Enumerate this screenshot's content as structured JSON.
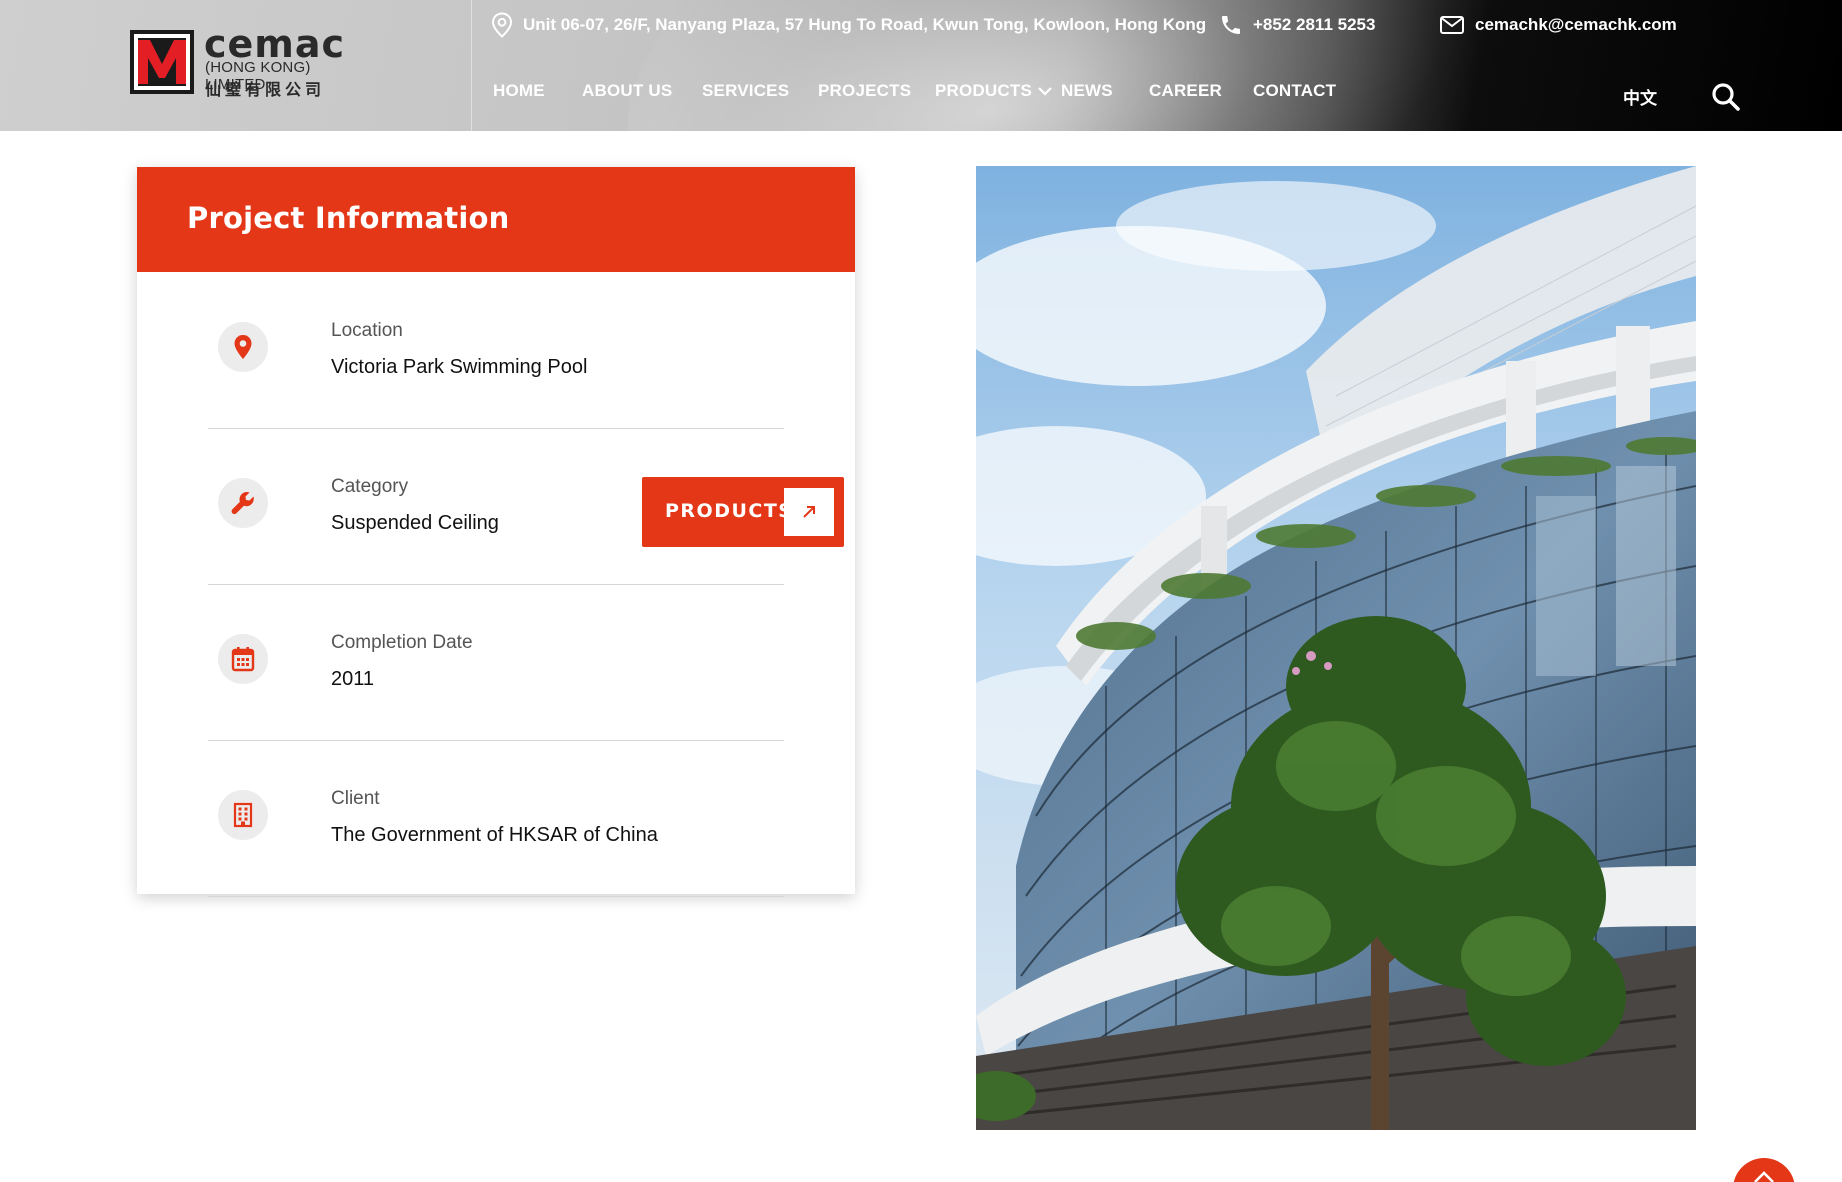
{
  "brand": {
    "name": "cemac",
    "subtitle": "(HONG KONG) LIMITED",
    "chinese_name": "仙璧有限公司",
    "logo_letter": "M",
    "primary_color": "#e33718"
  },
  "contact": {
    "address": "Unit 06-07, 26/F, Nanyang Plaza, 57 Hung To Road, Kwun Tong, Kowloon, Hong Kong",
    "phone": "+852 2811 5253",
    "email": "cemachk@cemachk.com"
  },
  "nav": {
    "items": [
      {
        "label": "HOME"
      },
      {
        "label": "ABOUT US"
      },
      {
        "label": "SERVICES"
      },
      {
        "label": "PROJECTS"
      },
      {
        "label": "PRODUCTS",
        "has_dropdown": true
      },
      {
        "label": "NEWS"
      },
      {
        "label": "CAREER"
      },
      {
        "label": "CONTACT"
      }
    ],
    "language_toggle": "中文",
    "search_icon": "search-icon"
  },
  "project_info": {
    "title": "Project Information",
    "rows": [
      {
        "label": "Location",
        "value": "Victoria Park Swimming Pool",
        "icon": "map-pin-icon"
      },
      {
        "label": "Category",
        "value": "Suspended Ceiling",
        "icon": "wrench-icon"
      },
      {
        "label": "Completion Date",
        "value": "2011",
        "icon": "calendar-icon"
      },
      {
        "label": "Client",
        "value": "The Government of HKSAR of China",
        "icon": "building-icon"
      }
    ],
    "products_button": "PRODUCTS"
  },
  "photo": {
    "subject": "curved glass facade of swimming pool building with tree"
  }
}
